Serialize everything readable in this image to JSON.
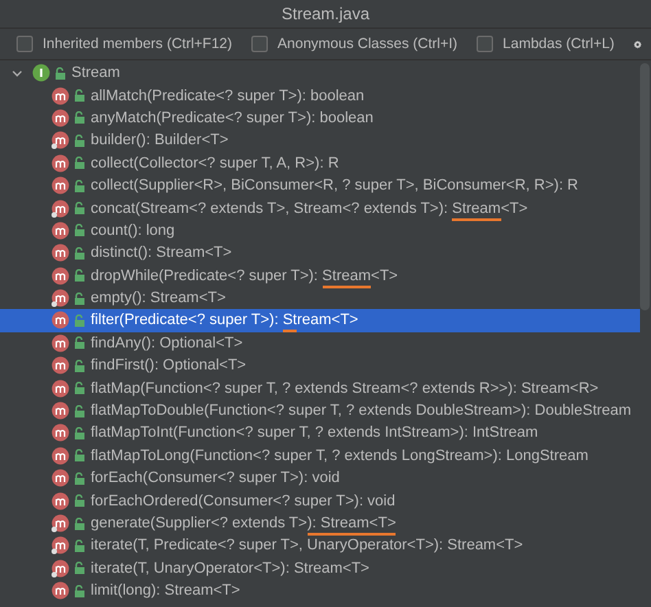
{
  "window": {
    "title": "Stream.java"
  },
  "filters": [
    {
      "label": "Inherited members (Ctrl+F12)",
      "checked": false
    },
    {
      "label": "Anonymous Classes (Ctrl+I)",
      "checked": false
    },
    {
      "label": "Lambdas (Ctrl+L)",
      "checked": false
    }
  ],
  "tree": {
    "label": "Stream",
    "expanded": true,
    "children": [
      {
        "text": "allMatch(Predicate<? super T>): boolean",
        "static": false,
        "selected": false
      },
      {
        "text": "anyMatch(Predicate<? super T>): boolean",
        "static": false,
        "selected": false
      },
      {
        "text": "builder(): Builder<T>",
        "static": true,
        "selected": false
      },
      {
        "text": "collect(Collector<? super T, A, R>): R",
        "static": false,
        "selected": false
      },
      {
        "text": "collect(Supplier<R>, BiConsumer<R, ? super T>, BiConsumer<R, R>): R",
        "static": false,
        "selected": false
      },
      {
        "text": "concat(Stream<? extends T>, Stream<? extends T>): ",
        "underlined": "Stream",
        "after": "<T>",
        "static": true,
        "selected": false
      },
      {
        "text": "count(): long",
        "static": false,
        "selected": false
      },
      {
        "text": "distinct(): Stream<T>",
        "static": false,
        "selected": false
      },
      {
        "text": "dropWhile(Predicate<? super T>): ",
        "underlined": "Stream",
        "after": "<T>",
        "static": false,
        "selected": false
      },
      {
        "text": "empty(): Stream<T>",
        "static": true,
        "selected": false
      },
      {
        "text": "filter(Predicate<? super T>): ",
        "underlined": "St",
        "after": "ream<T>",
        "static": false,
        "selected": true
      },
      {
        "text": "findAny(): Optional<T>",
        "static": false,
        "selected": false
      },
      {
        "text": "findFirst(): Optional<T>",
        "static": false,
        "selected": false
      },
      {
        "text": "flatMap(Function<? super T, ? extends Stream<? extends R>>): Stream<R>",
        "static": false,
        "selected": false
      },
      {
        "text": "flatMapToDouble(Function<? super T, ? extends DoubleStream>): DoubleStream",
        "static": false,
        "selected": false
      },
      {
        "text": "flatMapToInt(Function<? super T, ? extends IntStream>): IntStream",
        "static": false,
        "selected": false
      },
      {
        "text": "flatMapToLong(Function<? super T, ? extends LongStream>): LongStream",
        "static": false,
        "selected": false
      },
      {
        "text": "forEach(Consumer<? super T>): void",
        "static": false,
        "selected": false
      },
      {
        "text": "forEachOrdered(Consumer<? super T>): void",
        "static": false,
        "selected": false
      },
      {
        "text": "generate(Supplier<? extends T>",
        "underlined": "): Stream<T>",
        "static": true,
        "selected": false
      },
      {
        "text": "iterate(T, Predicate<? super T>, UnaryOperator<T>): Stream<T>",
        "static": true,
        "selected": false
      },
      {
        "text": "iterate(T, UnaryOperator<T>): Stream<T>",
        "static": true,
        "selected": false
      },
      {
        "text": "limit(long): Stream<T>",
        "static": false,
        "selected": false
      }
    ]
  }
}
